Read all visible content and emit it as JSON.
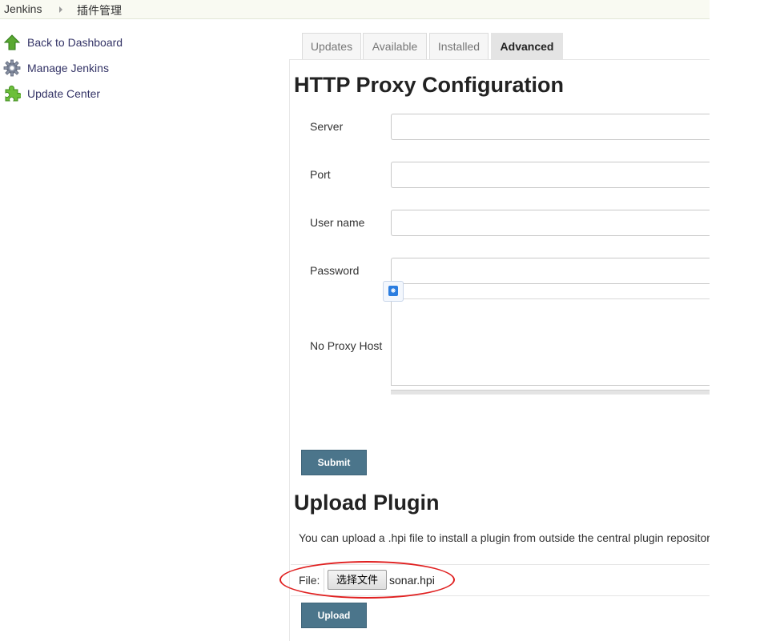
{
  "breadcrumb": {
    "root": "Jenkins",
    "current": "插件管理"
  },
  "sidebar": {
    "items": [
      {
        "label": "Back to Dashboard",
        "icon": "up-arrow-icon"
      },
      {
        "label": "Manage Jenkins",
        "icon": "gear-icon"
      },
      {
        "label": "Update Center",
        "icon": "puzzle-icon"
      }
    ]
  },
  "tabs": [
    {
      "label": "Updates",
      "active": false
    },
    {
      "label": "Available",
      "active": false
    },
    {
      "label": "Installed",
      "active": false
    },
    {
      "label": "Advanced",
      "active": true
    }
  ],
  "proxy": {
    "title": "HTTP Proxy Configuration",
    "server_label": "Server",
    "server_value": "",
    "port_label": "Port",
    "port_value": "",
    "username_label": "User name",
    "username_value": "",
    "password_label": "Password",
    "password_value": "",
    "noproxy_label": "No Proxy Host",
    "noproxy_value": "",
    "submit_label": "Submit"
  },
  "upload": {
    "title": "Upload Plugin",
    "description": "You can upload a .hpi file to install a plugin from outside the central plugin repository.",
    "file_label": "File:",
    "choose_label": "选择文件",
    "file_name": "sonar.hpi",
    "upload_label": "Upload"
  },
  "colors": {
    "button": "#4b758b",
    "annotation": "#e02020",
    "breadcrumb_bg": "#f9faf2"
  }
}
